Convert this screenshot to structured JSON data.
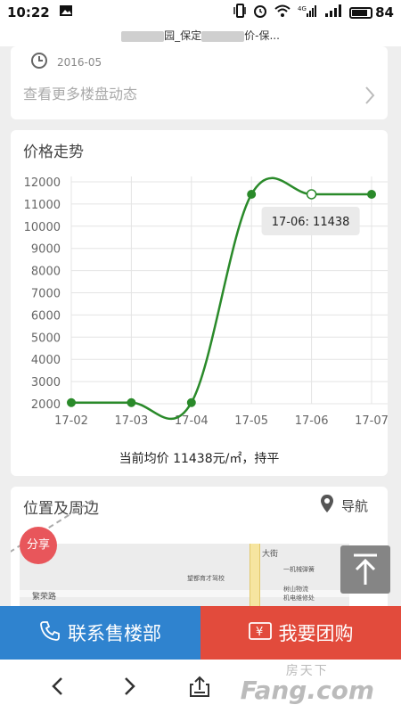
{
  "status_bar": {
    "time": "10:22",
    "battery": "84"
  },
  "browser": {
    "title_left": "园_保定",
    "title_right": "价-保..."
  },
  "dynamics": {
    "date": "2016-05",
    "more_link": "查看更多楼盘动态"
  },
  "price_trend": {
    "title": "价格走势",
    "tooltip": "17-06: 11438",
    "summary": "当前均价 11438元/㎡，持平"
  },
  "chart_data": {
    "type": "line",
    "title": "价格走势",
    "xlabel": "",
    "ylabel": "",
    "categories": [
      "17-02",
      "17-03",
      "17-04",
      "17-05",
      "17-06",
      "17-07"
    ],
    "series": [
      {
        "values": [
          2050,
          2050,
          2050,
          11438,
          11438,
          11438
        ]
      }
    ],
    "ylim": [
      2000,
      12000
    ],
    "yticks": [
      2000,
      3000,
      4000,
      5000,
      6000,
      7000,
      8000,
      9000,
      10000,
      11000,
      12000
    ],
    "grid": true,
    "color": "#2a8a2a",
    "highlight_index": 4
  },
  "location": {
    "title": "位置及周边",
    "nav_label": "导航"
  },
  "map_labels": [
    "大街",
    "一机械弹簧",
    "望都育才驾校",
    "树山物流",
    "机电维修处",
    "繁荣路"
  ],
  "share_label": "分享",
  "actions": {
    "call_label": "联系售楼部",
    "group_label": "我要团购"
  },
  "watermark": {
    "cn": "房天下",
    "en": "Fang.com"
  },
  "colors": {
    "call": "#2f83cf",
    "group": "#e24b3c",
    "share": "#e8565b",
    "line": "#2a8a2a"
  }
}
